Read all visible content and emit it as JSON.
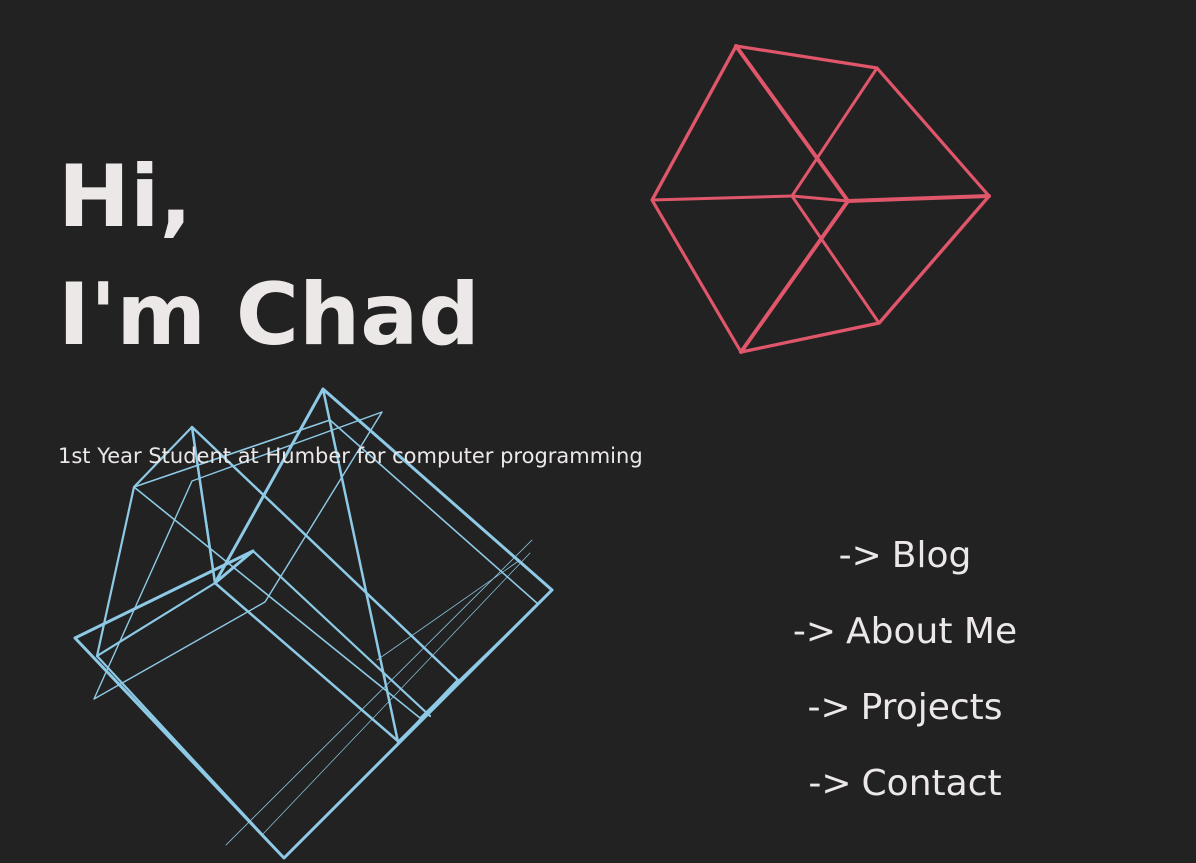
{
  "hero": {
    "line1": "Hi,",
    "line2": "I'm Chad",
    "subtitle": "1st Year Student at Humber for computer programming"
  },
  "nav": {
    "arrow": "->",
    "items": [
      {
        "label": "Blog"
      },
      {
        "label": "About Me"
      },
      {
        "label": "Projects"
      },
      {
        "label": "Contact"
      }
    ]
  },
  "colors": {
    "background": "#222222",
    "text": "#ece8e8",
    "wireframe_red": "#e0566a",
    "wireframe_blue": "#8ecae6"
  },
  "decorations": {
    "red_cube": "wireframe-cube",
    "blue_shape": "wireframe-box"
  }
}
